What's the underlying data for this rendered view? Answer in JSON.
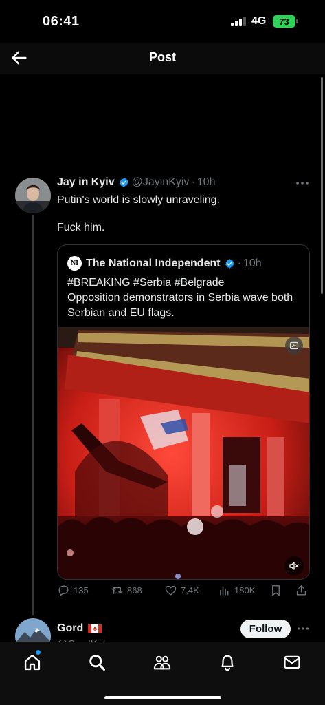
{
  "status_bar": {
    "time": "06:41",
    "network": "4G",
    "battery": "73"
  },
  "header": {
    "title": "Post"
  },
  "tweet": {
    "author": "Jay in Kyiv",
    "handle": "@JayinKyiv",
    "dot": "·",
    "time_ago": "10h",
    "text_line1": "Putin's world is slowly unraveling.",
    "text_line2": "Fuck him."
  },
  "quote": {
    "logo_text": "NI",
    "author": "The National Independent",
    "dot": "·",
    "time_ago": "10h",
    "hashtags": "#BREAKING #Serbia #Belgrade",
    "text": "Opposition demonstrators in Serbia wave both Serbian and EU flags."
  },
  "actions": {
    "replies": "135",
    "reposts": "868",
    "likes": "7,4K",
    "views": "180K"
  },
  "next_tweet": {
    "author": "Gord",
    "handle": "@GordKole",
    "follow_label": "Follow"
  },
  "colors": {
    "background": "#000000",
    "accent": "#1d9bf0",
    "secondary_text": "#71767b",
    "battery": "#30d158"
  },
  "icons": {
    "back": "arrow-left-icon",
    "verified": "verified-badge-icon",
    "more": "more-horizontal-icon",
    "reply": "reply-icon",
    "repost": "repost-icon",
    "like": "heart-icon",
    "views": "analytics-icon",
    "bookmark": "bookmark-icon",
    "share": "share-icon",
    "nav": [
      "home-icon",
      "search-icon",
      "communities-icon",
      "notifications-icon",
      "messages-icon"
    ]
  }
}
